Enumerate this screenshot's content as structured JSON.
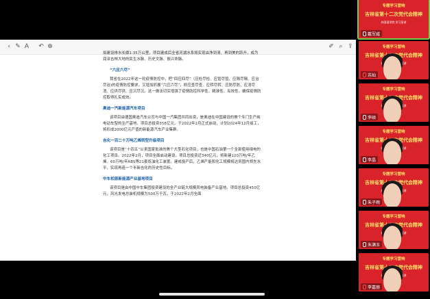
{
  "document": {
    "intro_paragraphs": [
      "拟建设排水长廊1.35万公里。项目建成后全省河湖水系将实现由净到清、再到美的跃升，成为润泽吉林大地的民生水脉、历史文脉、振兴命脉。"
    ],
    "sections": [
      {
        "title": "“六应六尽”",
        "body": "我省在2022年这一轮疫情防控中，把“四应四尽”（应检尽检、应管尽管、应隔尽隔、应治尽治)的疫情防控要求，又增加抓展“六应六尽”，即应查尽查、应转尽转、应防尽防、应消尽消、应供尽供、应沉尽沉。这一做法切实增强了疫情防控科学性、精准性、有效性，确保疫情防控取得扎实成效。"
      },
      {
        "title": "奥迪一汽新能源汽车项目",
        "body": "该项目由德国奥迪汽车公司与中国一汽集团共同出资，是奥迪在中国建设的首个专门生产纯电动车型的生产基地。项目总投资358亿元，于2022年2月正式启动，计划2024年12月竣工，将形成2000亿元产值的新能源汽车产业集群。"
      },
      {
        "title": "吉化一百二十万吨乙烯转型升级项目",
        "body": "该项目是“十四五”以来国家批准的首个大型石化项目，也是中国石油第一个全部使用绿电的化工项目。2022年2月，项目全面启动建设。项目总投资近340亿元，将新建120万吨/年乙烯、60万吨/年ABS等21套炼油化工装置。建成投产后，乙烯产能和化工规模将达到国内领先水平，实现再造一个半新吉化的历史性目标。"
      },
      {
        "title": "中车松原新能源产业基地项目",
        "body": "该项目是由中国中车集团投资建设的全产业链大规模风电装备产业基地。项目总投资450亿元，风光发电总装机规模为500万千瓦，于2022年2月全面"
      }
    ]
  },
  "toolbar": {
    "left_icons": [
      "back-icon",
      "pen-icon",
      "text-icon",
      "undo-icon",
      "add-icon"
    ],
    "right_icons": [
      "highlighter-icon",
      "search-icon",
      "share-icon"
    ]
  },
  "banner": {
    "top": "专题学习营响",
    "main": "吉林省第十二次党代会精神",
    "sub": "外国语学院 学习宣讲"
  },
  "participants": [
    {
      "name": "戴军威",
      "mic": "on",
      "active": true
    },
    {
      "name": "苏灿",
      "mic": "off",
      "active": false
    },
    {
      "name": "李硕",
      "mic": "on",
      "active": false
    },
    {
      "name": "李晶",
      "mic": "on",
      "active": false
    },
    {
      "name": "朱子雨",
      "mic": "on",
      "active": false
    },
    {
      "name": "朱满玉",
      "mic": "on",
      "active": false
    },
    {
      "name": "李嘉丽",
      "mic": "off",
      "active": false
    }
  ],
  "colors": {
    "section_title": "#1b5fa8",
    "banner_red": "#d8232a",
    "banner_gold": "#ffe06b",
    "active_outline": "#6fd04a"
  }
}
